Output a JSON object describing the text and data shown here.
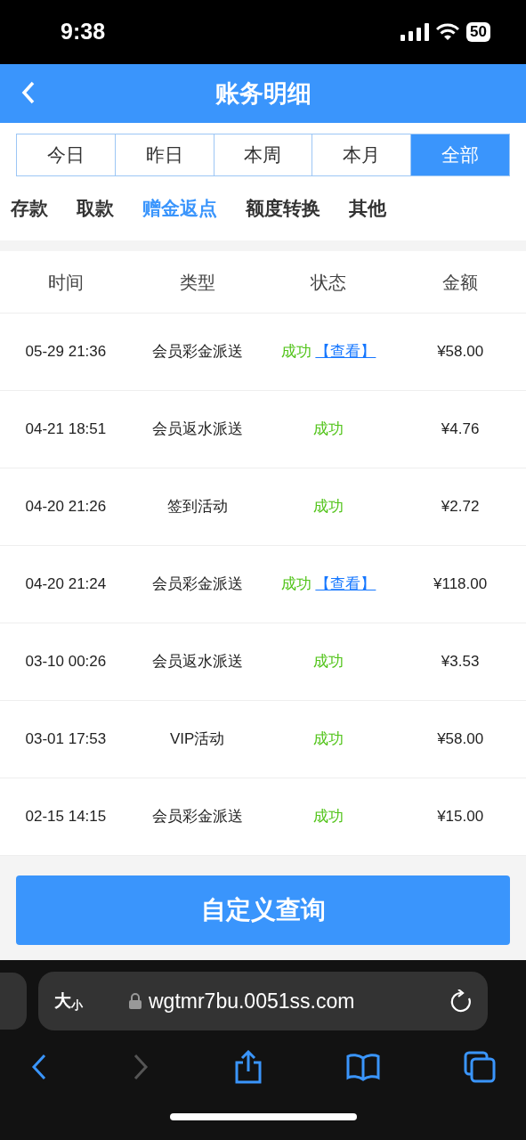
{
  "status_bar": {
    "time": "9:38",
    "battery": "50"
  },
  "header": {
    "title": "账务明细"
  },
  "periods": [
    {
      "label": "今日",
      "selected": false
    },
    {
      "label": "昨日",
      "selected": false
    },
    {
      "label": "本周",
      "selected": false
    },
    {
      "label": "本月",
      "selected": false
    },
    {
      "label": "全部",
      "selected": true
    }
  ],
  "categories": [
    {
      "label": "存款",
      "selected": false
    },
    {
      "label": "取款",
      "selected": false
    },
    {
      "label": "赠金返点",
      "selected": true
    },
    {
      "label": "额度转换",
      "selected": false
    },
    {
      "label": "其他",
      "selected": false
    }
  ],
  "table": {
    "columns": [
      "时间",
      "类型",
      "状态",
      "金额"
    ],
    "rows": [
      {
        "time": "05-29 21:36",
        "type": "会员彩金派送",
        "status": "成功",
        "link": "【查看】",
        "amount": "¥58.00"
      },
      {
        "time": "04-21 18:51",
        "type": "会员返水派送",
        "status": "成功",
        "amount": "¥4.76"
      },
      {
        "time": "04-20 21:26",
        "type": "签到活动",
        "status": "成功",
        "amount": "¥2.72"
      },
      {
        "time": "04-20 21:24",
        "type": "会员彩金派送",
        "status": "成功",
        "link": "【查看】",
        "amount": "¥118.00"
      },
      {
        "time": "03-10 00:26",
        "type": "会员返水派送",
        "status": "成功",
        "amount": "¥3.53"
      },
      {
        "time": "03-01 17:53",
        "type": "VIP活动",
        "status": "成功",
        "amount": "¥58.00"
      },
      {
        "time": "02-15 14:15",
        "type": "会员彩金派送",
        "status": "成功",
        "amount": "¥15.00"
      }
    ]
  },
  "query_button": "自定义查询",
  "browser": {
    "text_size": "大",
    "text_size_small": "小",
    "url": "wgtmr7bu.0051ss.com"
  }
}
